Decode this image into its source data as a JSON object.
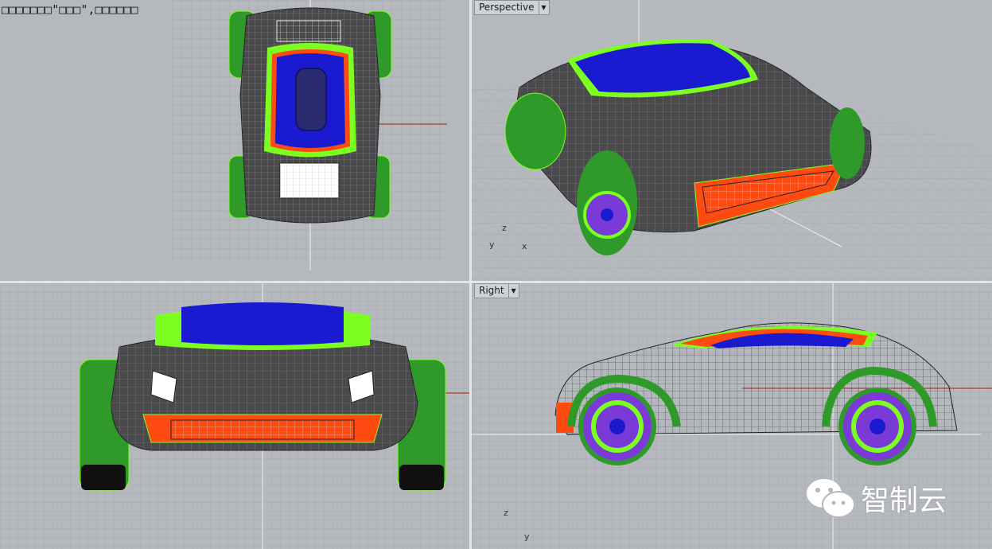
{
  "caption": "□□□□□□□\"□□□\",□□□□□□",
  "viewports": {
    "top_left": {
      "label": ""
    },
    "top_right": {
      "label": "Perspective"
    },
    "bottom_left": {
      "label": ""
    },
    "bottom_right": {
      "label": "Right"
    }
  },
  "axes": {
    "perspective": {
      "z": "z",
      "y": "y",
      "x": "x"
    },
    "right": {
      "z": "z",
      "y": "y"
    }
  },
  "watermark": {
    "text": "智制云"
  },
  "colors": {
    "background": "#b5b9be",
    "grid_line": "#a3a8ad",
    "x_axis": "#b23a3a",
    "y_axis": "#e8e8e8",
    "body_dark": "#3a3a3c",
    "wheel_green": "#2f9a2a",
    "highlight_blue": "#1a1ad0",
    "lime": "#7cff20",
    "orange": "#ff4a12",
    "purple": "#7a3ad8"
  }
}
